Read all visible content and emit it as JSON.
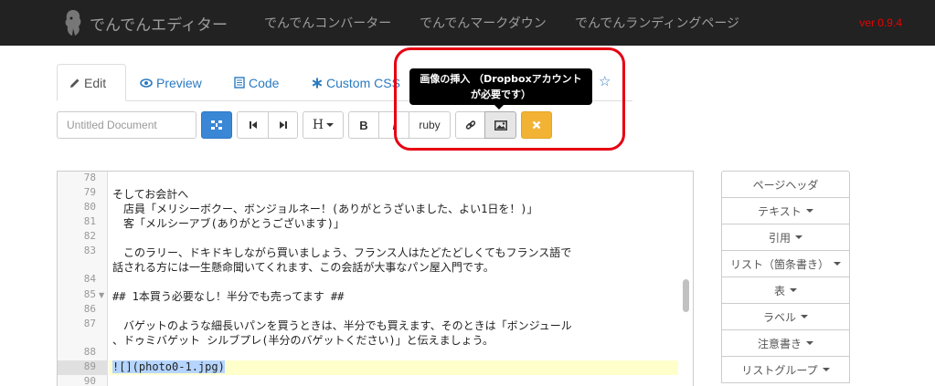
{
  "navbar": {
    "brand": "でんでんエディター",
    "links": [
      "でんでんコンバーター",
      "でんでんマークダウン",
      "でんでんランディングページ"
    ],
    "version": "ver 0.9.4"
  },
  "tabs": [
    {
      "label": "Edit",
      "icon": "pencil-icon",
      "active": true
    },
    {
      "label": "Preview",
      "icon": "eye-icon",
      "active": false
    },
    {
      "label": "Code",
      "icon": "code-file-icon",
      "active": false
    },
    {
      "label": "Custom CSS",
      "icon": "asterisk-icon",
      "active": false
    }
  ],
  "toolbar": {
    "title_placeholder": "Untitled Document",
    "heading_label": "H",
    "bold_label": "B",
    "italic_label": "I",
    "ruby_label": "ruby"
  },
  "tooltip": {
    "line1": "画像の挿入 （Dropboxアカウント",
    "line2": "が必要です）"
  },
  "editor": {
    "lines": [
      {
        "no": "78",
        "text": ""
      },
      {
        "no": "79",
        "text": "そしてお会計へ"
      },
      {
        "no": "80",
        "text": "　店員「メリシーボクー、ボンジョルネー！(ありがとうざいました、よい1日を！)」"
      },
      {
        "no": "81",
        "text": "　客「メルシーアブ(ありがとうございます)」"
      },
      {
        "no": "82",
        "text": ""
      },
      {
        "no": "83",
        "text": "　このラリー、ドキドキしながら買いましょう、フランス人はたどたどしくてもフランス語で"
      },
      {
        "no": "",
        "text": "話される方には一生懸命聞いてくれます、この会話が大事なパン屋入門です。"
      },
      {
        "no": "84",
        "text": ""
      },
      {
        "no": "85",
        "text": "## 1本買う必要なし！半分でも売ってます ##"
      },
      {
        "no": "86",
        "text": ""
      },
      {
        "no": "87",
        "text": "　バゲットのような細長いパンを買うときは、半分でも買えます、そのときは「ボンジュール"
      },
      {
        "no": "",
        "text": "、ドゥミバゲット シルブプレ(半分のバゲットください)」と伝えましょう。"
      },
      {
        "no": "88",
        "text": ""
      },
      {
        "no": "89",
        "text": "![](photo0-1.jpg)"
      },
      {
        "no": "90",
        "text": ""
      }
    ]
  },
  "side_panel": [
    {
      "label": "ページヘッダ",
      "caret": false
    },
    {
      "label": "テキスト",
      "caret": true
    },
    {
      "label": "引用",
      "caret": true
    },
    {
      "label": "リスト（箇条書き）",
      "caret": true
    },
    {
      "label": "表",
      "caret": true
    },
    {
      "label": "ラベル",
      "caret": true
    },
    {
      "label": "注意書き",
      "caret": true
    },
    {
      "label": "リストグループ",
      "caret": true
    }
  ],
  "colors": {
    "navbar_bg": "#222222",
    "accent_blue": "#2a7ac0",
    "primary_button": "#3a87d6",
    "warning_button": "#f2b233",
    "version_text": "#ee0000",
    "highlight_ring": "#e60012"
  }
}
